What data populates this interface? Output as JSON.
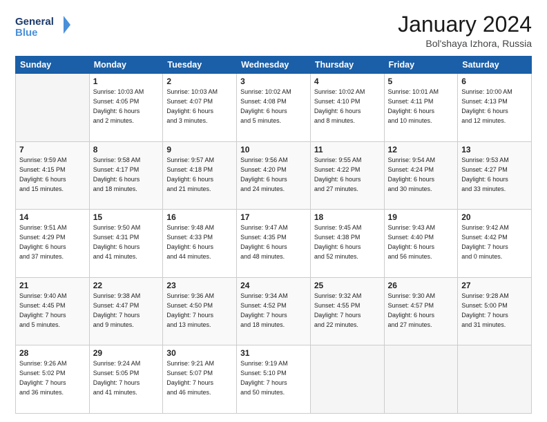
{
  "logo": {
    "line1": "General",
    "line2": "Blue"
  },
  "title": "January 2024",
  "subtitle": "Bol'shaya Izhora, Russia",
  "days_of_week": [
    "Sunday",
    "Monday",
    "Tuesday",
    "Wednesday",
    "Thursday",
    "Friday",
    "Saturday"
  ],
  "weeks": [
    [
      {
        "day": "",
        "info": ""
      },
      {
        "day": "1",
        "info": "Sunrise: 10:03 AM\nSunset: 4:05 PM\nDaylight: 6 hours\nand 2 minutes."
      },
      {
        "day": "2",
        "info": "Sunrise: 10:03 AM\nSunset: 4:07 PM\nDaylight: 6 hours\nand 3 minutes."
      },
      {
        "day": "3",
        "info": "Sunrise: 10:02 AM\nSunset: 4:08 PM\nDaylight: 6 hours\nand 5 minutes."
      },
      {
        "day": "4",
        "info": "Sunrise: 10:02 AM\nSunset: 4:10 PM\nDaylight: 6 hours\nand 8 minutes."
      },
      {
        "day": "5",
        "info": "Sunrise: 10:01 AM\nSunset: 4:11 PM\nDaylight: 6 hours\nand 10 minutes."
      },
      {
        "day": "6",
        "info": "Sunrise: 10:00 AM\nSunset: 4:13 PM\nDaylight: 6 hours\nand 12 minutes."
      }
    ],
    [
      {
        "day": "7",
        "info": "Sunrise: 9:59 AM\nSunset: 4:15 PM\nDaylight: 6 hours\nand 15 minutes."
      },
      {
        "day": "8",
        "info": "Sunrise: 9:58 AM\nSunset: 4:17 PM\nDaylight: 6 hours\nand 18 minutes."
      },
      {
        "day": "9",
        "info": "Sunrise: 9:57 AM\nSunset: 4:18 PM\nDaylight: 6 hours\nand 21 minutes."
      },
      {
        "day": "10",
        "info": "Sunrise: 9:56 AM\nSunset: 4:20 PM\nDaylight: 6 hours\nand 24 minutes."
      },
      {
        "day": "11",
        "info": "Sunrise: 9:55 AM\nSunset: 4:22 PM\nDaylight: 6 hours\nand 27 minutes."
      },
      {
        "day": "12",
        "info": "Sunrise: 9:54 AM\nSunset: 4:24 PM\nDaylight: 6 hours\nand 30 minutes."
      },
      {
        "day": "13",
        "info": "Sunrise: 9:53 AM\nSunset: 4:27 PM\nDaylight: 6 hours\nand 33 minutes."
      }
    ],
    [
      {
        "day": "14",
        "info": "Sunrise: 9:51 AM\nSunset: 4:29 PM\nDaylight: 6 hours\nand 37 minutes."
      },
      {
        "day": "15",
        "info": "Sunrise: 9:50 AM\nSunset: 4:31 PM\nDaylight: 6 hours\nand 41 minutes."
      },
      {
        "day": "16",
        "info": "Sunrise: 9:48 AM\nSunset: 4:33 PM\nDaylight: 6 hours\nand 44 minutes."
      },
      {
        "day": "17",
        "info": "Sunrise: 9:47 AM\nSunset: 4:35 PM\nDaylight: 6 hours\nand 48 minutes."
      },
      {
        "day": "18",
        "info": "Sunrise: 9:45 AM\nSunset: 4:38 PM\nDaylight: 6 hours\nand 52 minutes."
      },
      {
        "day": "19",
        "info": "Sunrise: 9:43 AM\nSunset: 4:40 PM\nDaylight: 6 hours\nand 56 minutes."
      },
      {
        "day": "20",
        "info": "Sunrise: 9:42 AM\nSunset: 4:42 PM\nDaylight: 7 hours\nand 0 minutes."
      }
    ],
    [
      {
        "day": "21",
        "info": "Sunrise: 9:40 AM\nSunset: 4:45 PM\nDaylight: 7 hours\nand 5 minutes."
      },
      {
        "day": "22",
        "info": "Sunrise: 9:38 AM\nSunset: 4:47 PM\nDaylight: 7 hours\nand 9 minutes."
      },
      {
        "day": "23",
        "info": "Sunrise: 9:36 AM\nSunset: 4:50 PM\nDaylight: 7 hours\nand 13 minutes."
      },
      {
        "day": "24",
        "info": "Sunrise: 9:34 AM\nSunset: 4:52 PM\nDaylight: 7 hours\nand 18 minutes."
      },
      {
        "day": "25",
        "info": "Sunrise: 9:32 AM\nSunset: 4:55 PM\nDaylight: 7 hours\nand 22 minutes."
      },
      {
        "day": "26",
        "info": "Sunrise: 9:30 AM\nSunset: 4:57 PM\nDaylight: 6 hours\nand 27 minutes."
      },
      {
        "day": "27",
        "info": "Sunrise: 9:28 AM\nSunset: 5:00 PM\nDaylight: 7 hours\nand 31 minutes."
      }
    ],
    [
      {
        "day": "28",
        "info": "Sunrise: 9:26 AM\nSunset: 5:02 PM\nDaylight: 7 hours\nand 36 minutes."
      },
      {
        "day": "29",
        "info": "Sunrise: 9:24 AM\nSunset: 5:05 PM\nDaylight: 7 hours\nand 41 minutes."
      },
      {
        "day": "30",
        "info": "Sunrise: 9:21 AM\nSunset: 5:07 PM\nDaylight: 7 hours\nand 46 minutes."
      },
      {
        "day": "31",
        "info": "Sunrise: 9:19 AM\nSunset: 5:10 PM\nDaylight: 7 hours\nand 50 minutes."
      },
      {
        "day": "",
        "info": ""
      },
      {
        "day": "",
        "info": ""
      },
      {
        "day": "",
        "info": ""
      }
    ]
  ]
}
